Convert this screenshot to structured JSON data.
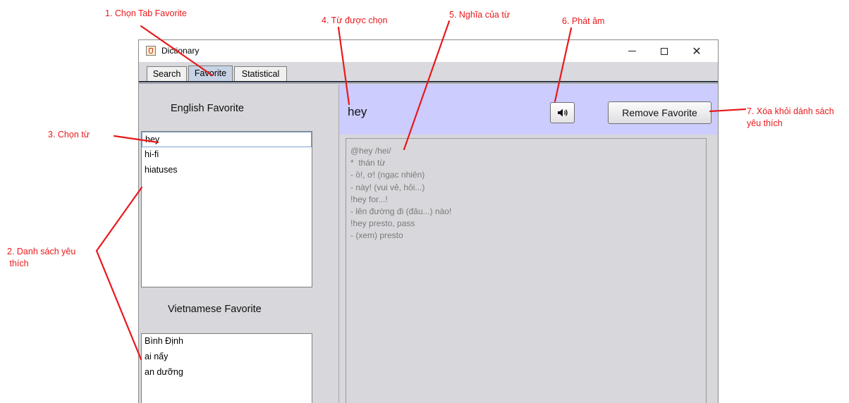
{
  "window": {
    "title": "Dictionary",
    "controls": [
      "minimize",
      "maximize",
      "close"
    ]
  },
  "tabs": [
    {
      "label": "Search",
      "active": false
    },
    {
      "label": "Favorite",
      "active": true
    },
    {
      "label": "Statistical",
      "active": false
    }
  ],
  "favorites": {
    "english_heading": "English Favorite",
    "english_items": [
      "hey",
      "hi-fi",
      "hiatuses"
    ],
    "english_selected": "hey",
    "vietnamese_heading": "Vietnamese Favorite",
    "vietnamese_items": [
      "Bình Định",
      "ai nấy",
      "an dưỡng"
    ]
  },
  "detail": {
    "word": "hey",
    "speaker_icon": "speaker-icon",
    "remove_label": "Remove Favorite",
    "meaning_lines": [
      "@hey /hei/",
      "*  thán từ",
      "- ồ!, ơ! (ngạc nhiên)",
      "- này! (vui vẻ, hỏi...)",
      "!hey for...!",
      "- lên đường đi (đâu...) nào!",
      "!hey presto, pass",
      "- (xem) presto"
    ]
  },
  "annotations": {
    "a1": "1. Chọn Tab Favorite",
    "a2_line1": "2. Danh sách yêu",
    "a2_line2": " thích",
    "a3": "3. Chọn từ",
    "a4": "4. Từ được chọn",
    "a5": "5. Nghĩa của từ",
    "a6": "6. Phát âm",
    "a7_line1": "7. Xóa khỏi dánh sách",
    "a7_line2": "yêu thích"
  },
  "colors": {
    "annotation": "#e8191b",
    "word_bar": "#ccccff",
    "active_tab": "#c6d3e6"
  }
}
